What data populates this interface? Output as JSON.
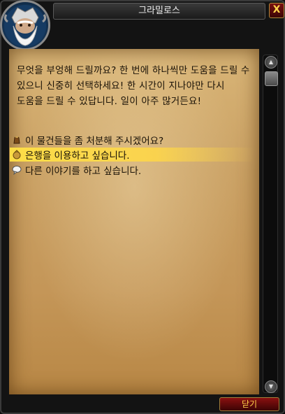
{
  "window": {
    "title": "그라밀로스",
    "close_glyph": "X"
  },
  "npc": {
    "portrait_icon": "dwarf-portrait-icon"
  },
  "greeting_text": "무엇을 부엉해 드릴까요? 한 번에 하나씩만 도움을 드릴 수 있으니 신중히 선택하세요! 한 시간이 지나야만 다시 도움을 드릴 수 있답니다. 일이 아주 많거든요!",
  "options": [
    {
      "label": "이 물건들을 좀 처분해 주시겠어요?",
      "icon": "bag-icon",
      "highlighted": false
    },
    {
      "label": "은행을 이용하고 싶습니다.",
      "icon": "bank-icon",
      "highlighted": true
    },
    {
      "label": "다른 이야기를 하고 싶습니다.",
      "icon": "chat-bubble-icon",
      "highlighted": false
    }
  ],
  "footer": {
    "goodbye_label": "닫기"
  },
  "scroll": {
    "up_glyph": "▲",
    "down_glyph": "▼"
  },
  "colors": {
    "parchment": "#caa164",
    "text": "#1a1207",
    "highlight": "#ffe046",
    "button_red": "#8a1010",
    "button_text": "#ffd34a"
  }
}
